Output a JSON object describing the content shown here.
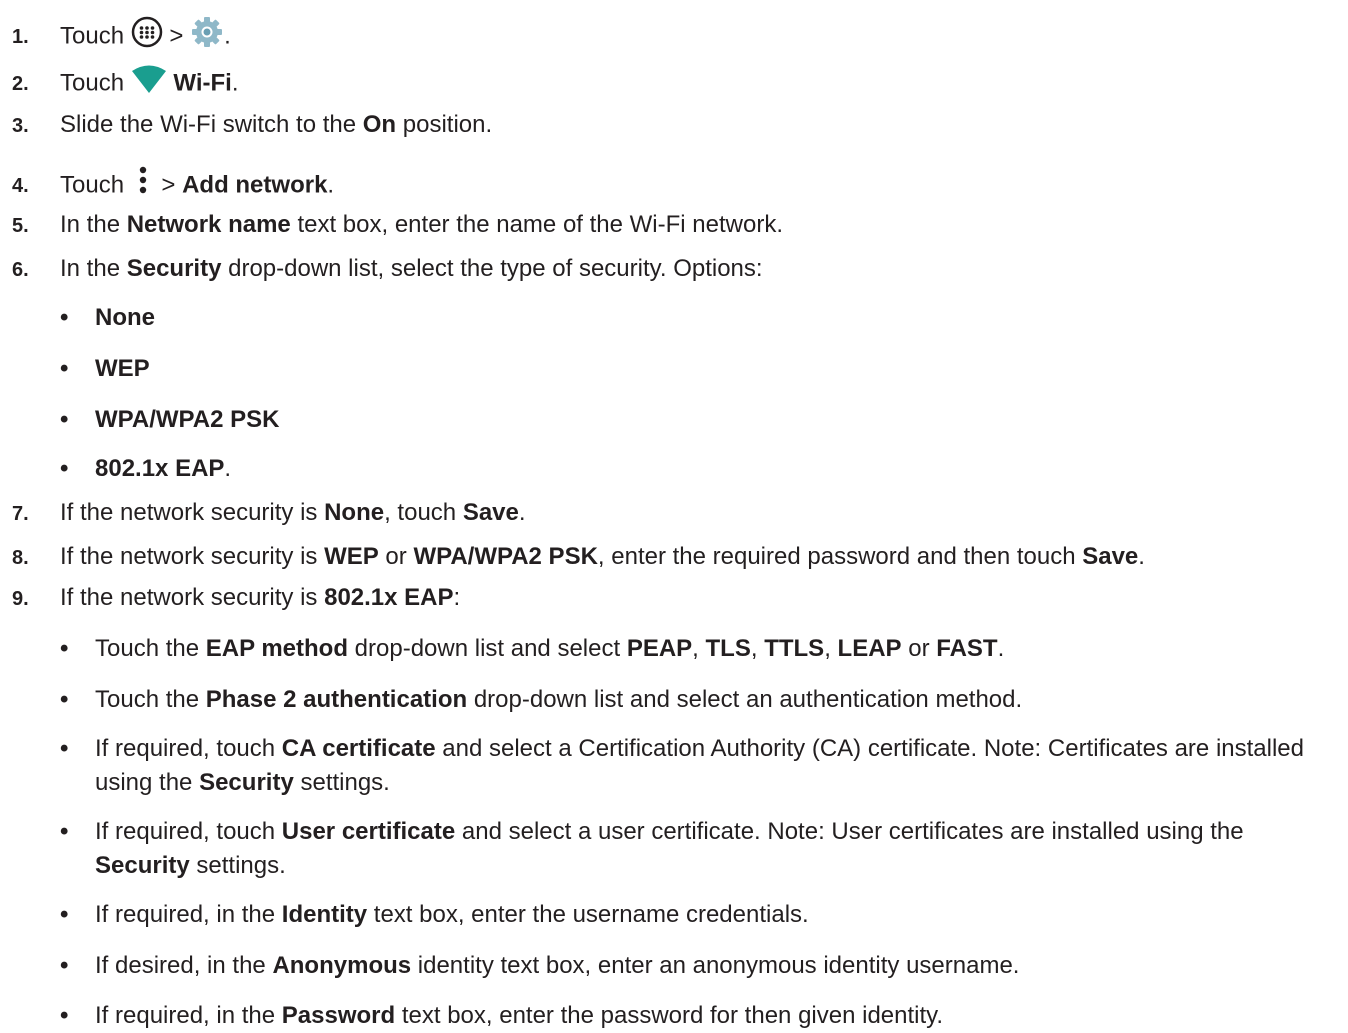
{
  "steps": [
    {
      "num": "1.",
      "touch": "Touch",
      "gt": ">",
      "period": "."
    },
    {
      "num": "2.",
      "touch": "Touch",
      "wifi": "Wi-Fi",
      "period": "."
    },
    {
      "num": "3.",
      "text_a": "Slide the Wi-Fi switch to the ",
      "on": "On",
      "text_b": " position."
    },
    {
      "num": "4.",
      "touch": "Touch",
      "gt": ">",
      "add_network": "Add network",
      "period": "."
    },
    {
      "num": "5.",
      "text_a": "In the ",
      "network_name": "Network name",
      "text_b": " text box, enter the name of the Wi-Fi network."
    },
    {
      "num": "6.",
      "text_a": "In the ",
      "security": "Security",
      "text_b": " drop-down list, select the type of security. Options:"
    },
    {
      "num": "7.",
      "text_a": "If the network security is ",
      "none": "None",
      "text_b": ", touch ",
      "save": "Save",
      "text_c": "."
    },
    {
      "num": "8.",
      "text_a": "If the network security is ",
      "wep": "WEP",
      "text_b": " or ",
      "wpa": "WPA/WPA2 PSK",
      "text_c": ", enter the required password and then touch ",
      "save": "Save",
      "text_d": "."
    },
    {
      "num": "9.",
      "text_a": "If the network security is ",
      "eap": "802.1x EAP",
      "text_b": ":"
    }
  ],
  "security_options": [
    "None",
    "WEP",
    "WPA/WPA2 PSK",
    "802.1x EAP"
  ],
  "security_options_last_suffix": ".",
  "eap_bullets": {
    "b1": {
      "a": "Touch the ",
      "eap_method": "EAP method",
      "b": " drop-down list and select ",
      "peap": "PEAP",
      "c": ", ",
      "tls": "TLS",
      "d": ", ",
      "ttls": "TTLS",
      "e": ", ",
      "leap": "LEAP",
      "f": " or ",
      "fast": "FAST",
      "g": "."
    },
    "b2": {
      "a": "Touch the ",
      "phase2": "Phase 2 authentication",
      "b": " drop-down list and select an authentication method."
    },
    "b3": {
      "a": "If required, touch ",
      "ca": "CA certificate",
      "b": " and select a Certification Authority (CA) certificate. Note: Certificates are installed using the ",
      "security": "Security",
      "c": " settings."
    },
    "b4": {
      "a": "If required, touch ",
      "user_cert": "User certificate",
      "b": " and select a user certificate. Note: User certificates are installed using the ",
      "security": "Security",
      "c": " settings."
    },
    "b5": {
      "a": "If required, in the ",
      "identity": "Identity",
      "b": " text box, enter the username credentials."
    },
    "b6": {
      "a": "If desired, in the ",
      "anonymous": "Anonymous",
      "b": " identity text box, enter an anonymous identity username."
    },
    "b7": {
      "a": "If required, in the ",
      "password": "Password",
      "b": " text box, enter the password for then given identity."
    }
  },
  "bullet_char": "•",
  "icons": {
    "apps": "apps-grid-icon",
    "settings": "settings-gear-icon",
    "wifi": "wifi-icon",
    "overflow": "overflow-menu-icon"
  },
  "colors": {
    "text": "#231f20",
    "wifi": "#1a9e8f",
    "gear": "#8fb8c8"
  }
}
